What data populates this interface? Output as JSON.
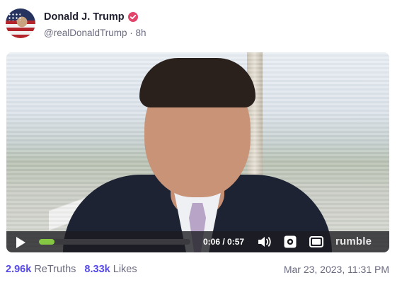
{
  "post": {
    "display_name": "Donald J. Trump",
    "handle_line": "@realDonaldTrump · 8h",
    "timestamp": "Mar 23, 2023, 11:31 PM"
  },
  "icons": {
    "avatar": "avatar-flag-portrait",
    "verified": "verified-badge-icon",
    "play": "play-icon",
    "volume": "volume-icon",
    "settings": "settings-icon",
    "theater": "theater-mode-icon"
  },
  "colors": {
    "accent": "#5448ee",
    "verified": "#e2456a",
    "progress": "#85c742"
  },
  "video": {
    "time": "0:06 / 0:57",
    "progress_fraction": 0.105,
    "brand": "rumble"
  },
  "stats": {
    "retruths_count": "2.96k",
    "retruths_label": "ReTruths",
    "likes_count": "8.33k",
    "likes_label": "Likes"
  }
}
